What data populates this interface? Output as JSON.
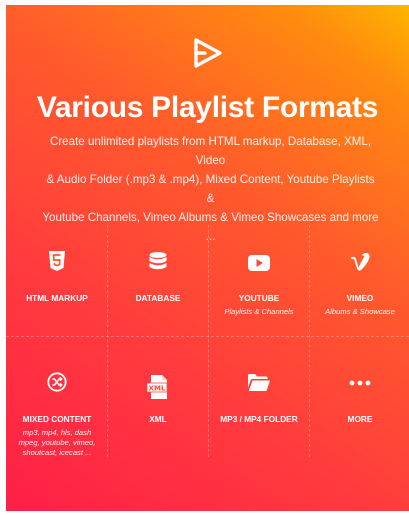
{
  "banner": {
    "logo_icon": "play-arrow-icon",
    "title": "Various Playlist Formats",
    "description_lines": [
      "Create unlimited playlists from HTML markup, Database, XML, Video",
      "& Audio Folder (.mp3 & .mp4), Mixed Content, Youtube Playlists &",
      "Youtube Channels, Vimeo Albums & Vimeo Showcases and more ..."
    ]
  },
  "features": [
    {
      "label": "HTML MARKUP",
      "icon": "html5-icon",
      "sub": []
    },
    {
      "label": "DATABASE",
      "icon": "database-icon",
      "sub": []
    },
    {
      "label": "YOUTUBE",
      "icon": "youtube-icon",
      "sub": [
        "Playlists & Channels"
      ]
    },
    {
      "label": "VIMEO",
      "icon": "vimeo-icon",
      "sub": [
        "Albums & Showcase"
      ]
    },
    {
      "label": "MIXED CONTENT",
      "icon": "shuffle-icon",
      "sub": [
        "mp3, mp4, hls, dash",
        "mpeg, youtube, vimeo,",
        "shoutcast, icecast ..."
      ]
    },
    {
      "label": "XML",
      "icon": "xml-file-icon",
      "sub": []
    },
    {
      "label": "MP3 /  MP4 FOLDER",
      "icon": "folder-icon",
      "sub": []
    },
    {
      "label": "MORE",
      "icon": "more-dots-icon",
      "sub": []
    }
  ]
}
